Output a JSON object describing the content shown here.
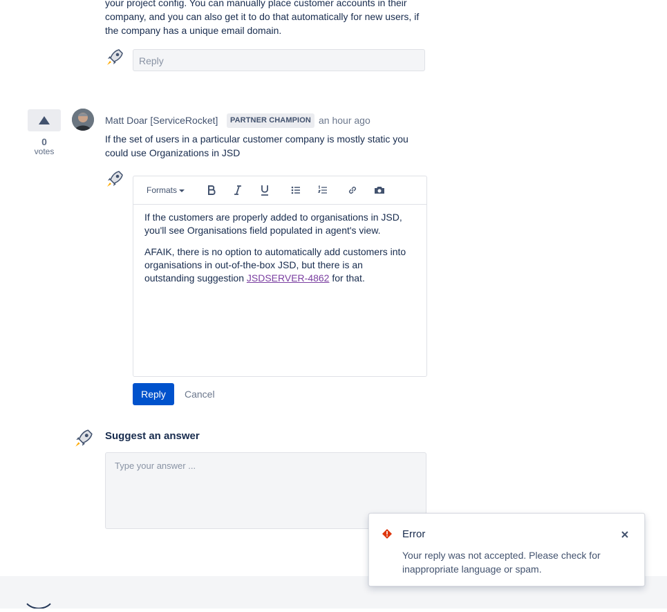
{
  "previous_comment": {
    "text": "your project config. You can manually place customer accounts in their company, and you can also get it to do that automatically for new users, if the company has a unique email domain.",
    "reply_placeholder": "Reply"
  },
  "answer": {
    "votes": "0",
    "votes_label": "votes",
    "author": "Matt Doar [ServiceRocket]",
    "badge": "PARTNER CHAMPION",
    "time": "an hour ago",
    "text": "If the set of users in a particular customer company is mostly static you could use Organizations in JSD"
  },
  "editor": {
    "formats_label": "Formats",
    "toolbar_icons": [
      "bold-icon",
      "italic-icon",
      "underline-icon",
      "bullet-list-icon",
      "numbered-list-icon",
      "link-icon",
      "camera-icon"
    ],
    "paragraph1": "If the customers are properly added to organisations in JSD, you'll see Organisations field populated in agent's view.",
    "paragraph2_before": "AFAIK, there is no option to automatically add customers into organisations in out-of-the-box JSD, but there is an outstanding suggestion ",
    "paragraph2_link": "JSDSERVER-4862",
    "paragraph2_after": " for that.",
    "reply_button": "Reply",
    "cancel_button": "Cancel"
  },
  "suggest": {
    "title": "Suggest an answer",
    "placeholder": "Type your answer ..."
  },
  "toast": {
    "title": "Error",
    "message": "Your reply was not accepted. Please check for inappropriate language or spam."
  },
  "colors": {
    "primary": "#0052cc",
    "error": "#de350b",
    "link_visited": "#7a3ea0"
  }
}
